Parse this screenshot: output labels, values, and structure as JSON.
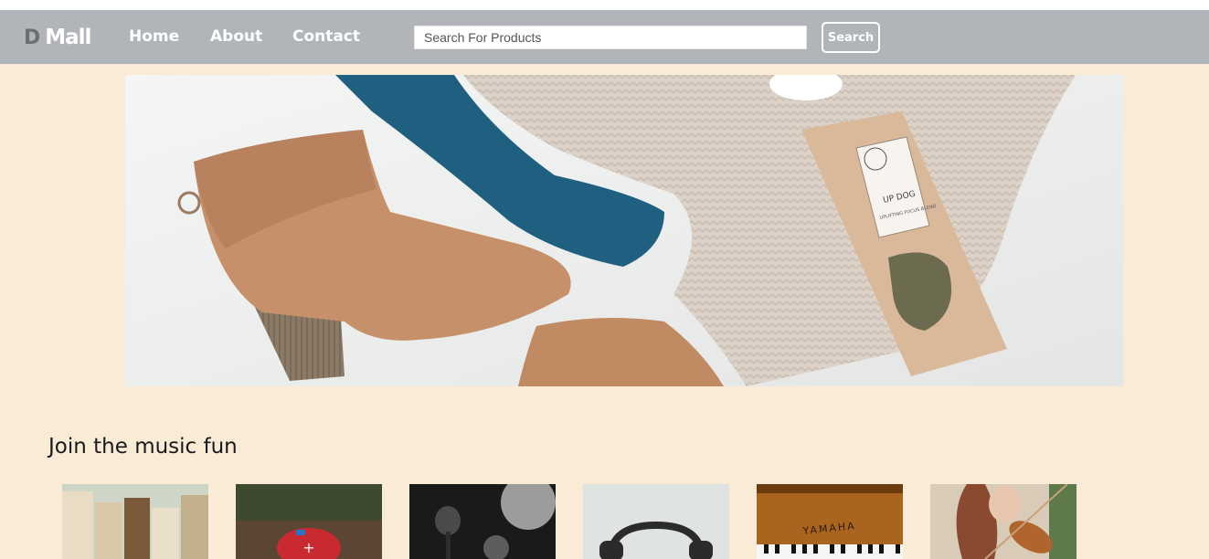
{
  "brand": {
    "icon": "D",
    "name": "Mall"
  },
  "nav": {
    "home": "Home",
    "about": "About",
    "contact": "Contact"
  },
  "search": {
    "placeholder": "Search For Products",
    "value": "",
    "button": "Search"
  },
  "hero": {
    "label_title": "UP DOG",
    "label_sub": "UPLIFTING FOCUS BLEND"
  },
  "music_section": {
    "title": "Join the music fun"
  },
  "thumbnails": [
    {
      "alt": "books"
    },
    {
      "alt": "red speaker"
    },
    {
      "alt": "microphone"
    },
    {
      "alt": "headphones"
    },
    {
      "alt": "piano",
      "text": "YAMAHA"
    },
    {
      "alt": "violin player"
    }
  ]
}
